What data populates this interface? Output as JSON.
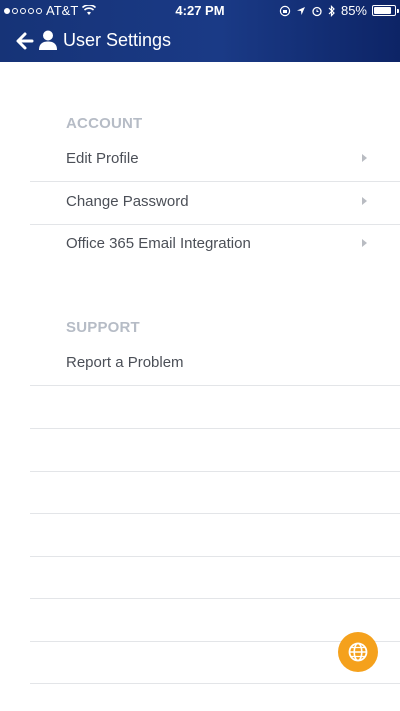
{
  "status_bar": {
    "carrier": "AT&T",
    "time": "4:27 PM",
    "battery_percent_text": "85%",
    "battery_level": 0.85
  },
  "nav": {
    "title": "User Settings"
  },
  "sections": {
    "account": {
      "header": "ACCOUNT",
      "items": [
        {
          "label": "Edit Profile"
        },
        {
          "label": "Change Password"
        },
        {
          "label": "Office 365 Email Integration"
        }
      ]
    },
    "support": {
      "header": "SUPPORT",
      "items": [
        {
          "label": "Report a Problem"
        }
      ]
    }
  },
  "colors": {
    "header_bg": "#163377",
    "fab_bg": "#f5a11c",
    "section_header": "#b6bcc6",
    "row_text": "#4b4f57"
  },
  "icons": {
    "back": "arrow-left-icon",
    "user": "user-icon",
    "chevron": "chevron-right-icon",
    "fab": "globe-icon"
  }
}
